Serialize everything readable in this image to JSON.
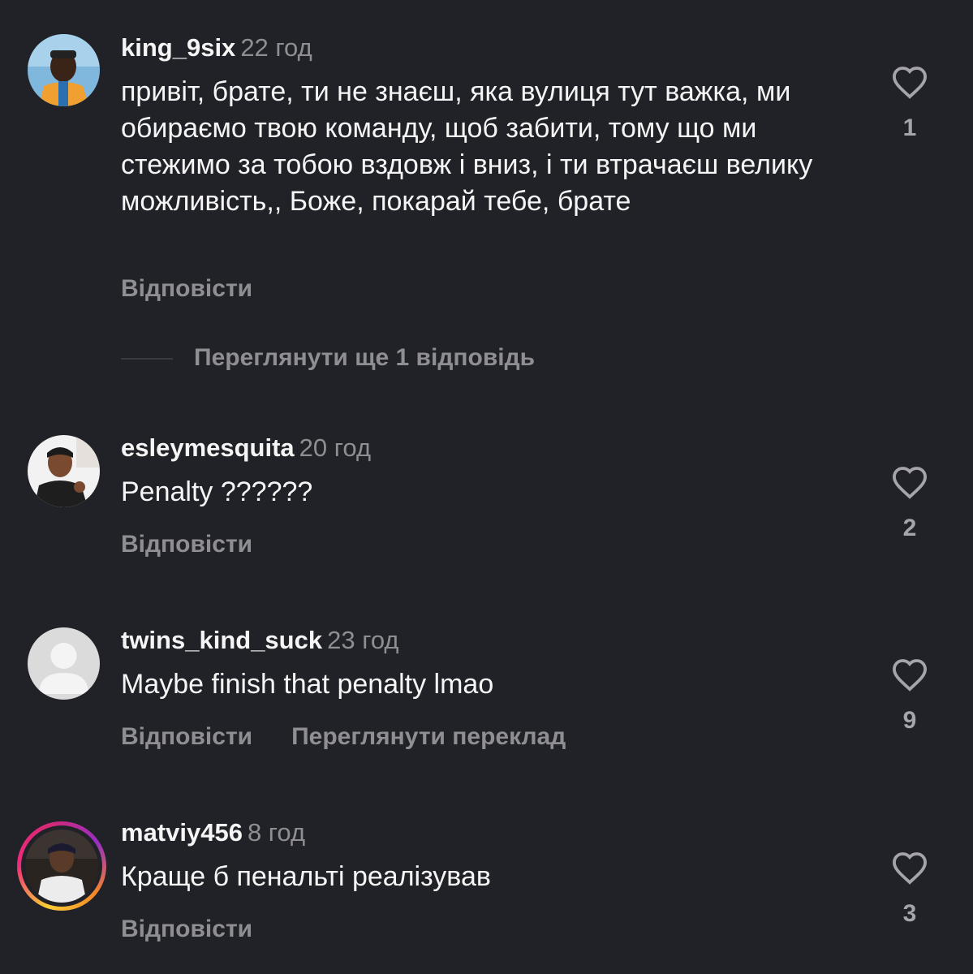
{
  "comments": [
    {
      "username": "king_9six",
      "time": "22 год",
      "text": "привіт, брате, ти не знаєш, яка вулиця тут важка, ми обираємо твою команду, щоб забити, тому що ми стежимо за тобою вздовж і вниз, і ти втрачаєш велику можливість,, Боже, покарай тебе, брате",
      "reply_label": "Відповісти",
      "likes": "1"
    },
    {
      "username": "esleymesquita",
      "time": "20 год",
      "text": "Penalty ??????",
      "reply_label": "Відповісти",
      "likes": "2"
    },
    {
      "username": "twins_kind_suck",
      "time": "23 год",
      "text": "Maybe finish that penalty lmao",
      "reply_label": "Відповісти",
      "translate_label": "Переглянути переклад",
      "likes": "9"
    },
    {
      "username": "matviy456",
      "time": "8 год",
      "text": "Краще б пенальті реалізував",
      "reply_label": "Відповісти",
      "likes": "3"
    }
  ],
  "view_replies": "Переглянути ще 1 відповідь",
  "icons": {
    "like": "heart-outline-icon",
    "default_avatar": "user-silhouette-icon"
  },
  "colors": {
    "background": "#212227",
    "primary_text": "#f5f5f5",
    "secondary_text": "#8e8e93",
    "story_ring": "#ee2a7b"
  }
}
